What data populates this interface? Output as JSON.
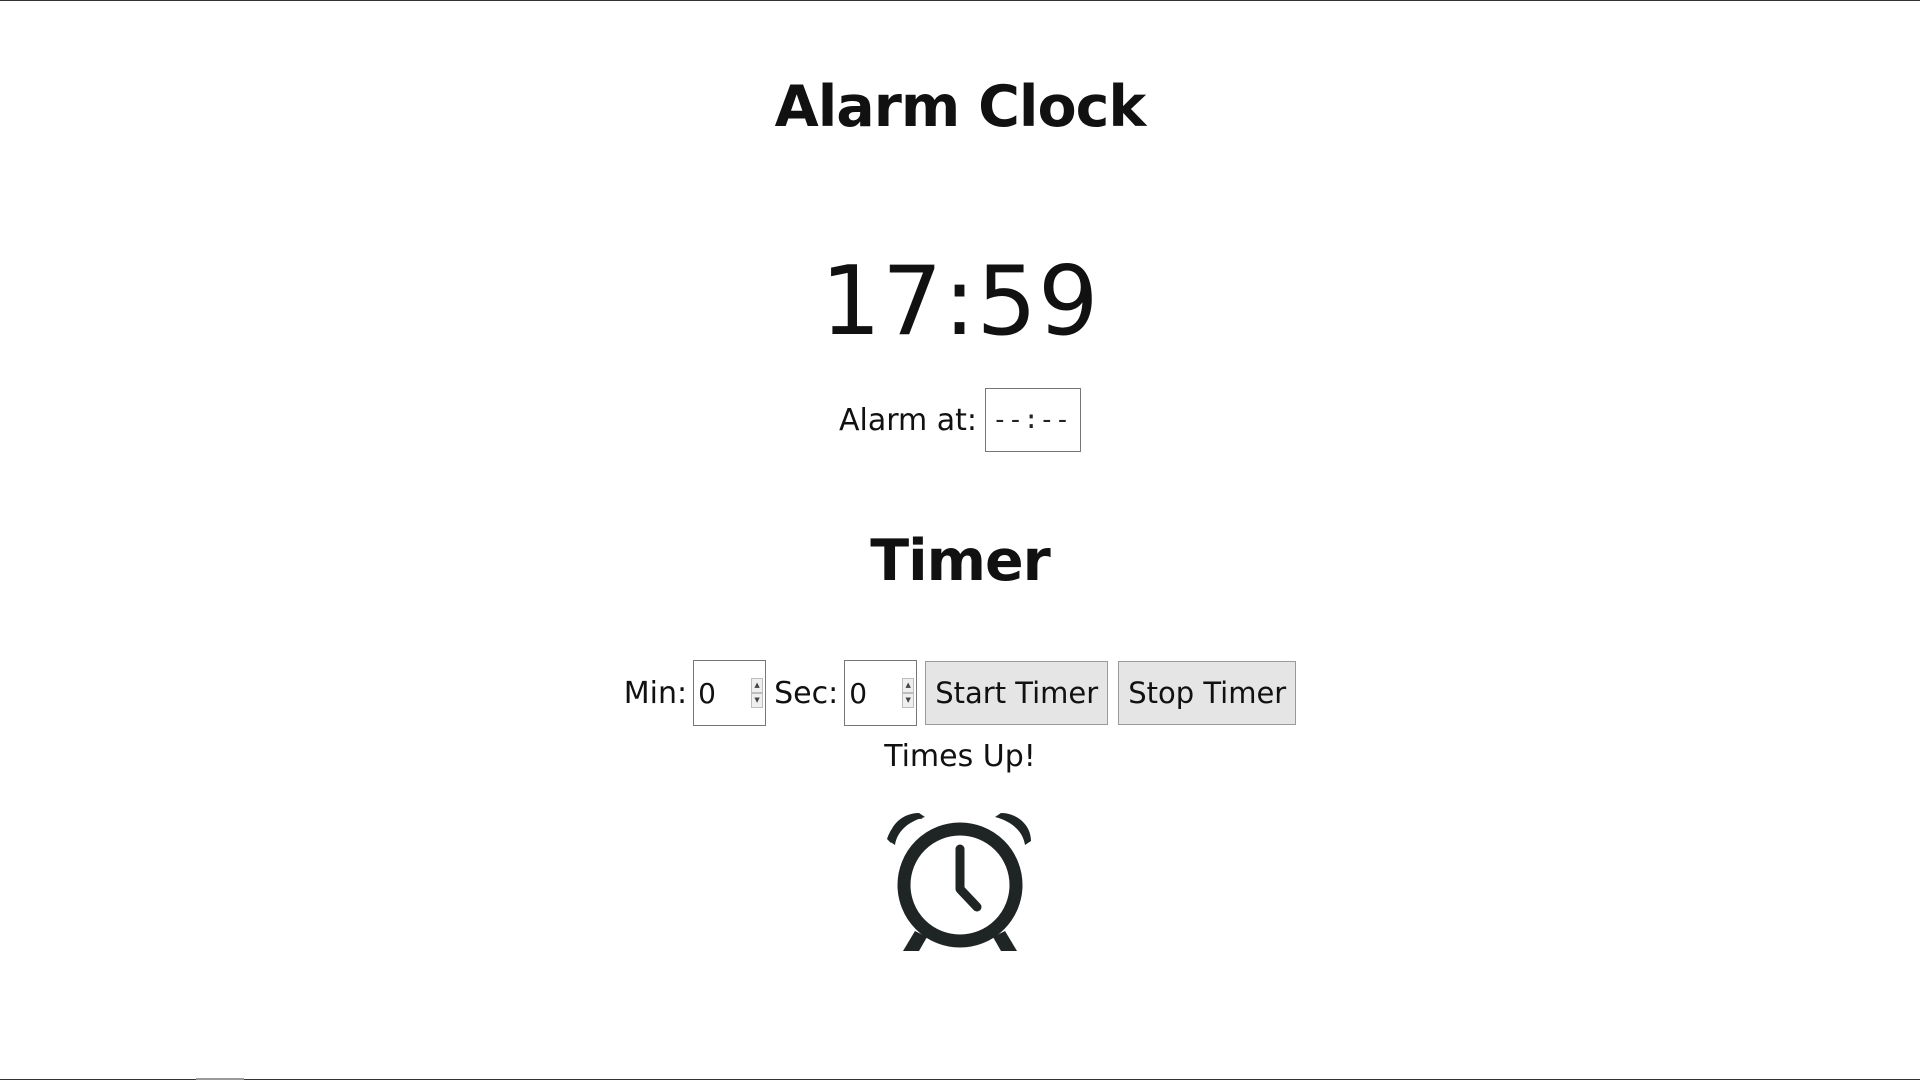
{
  "header": {
    "title": "Alarm Clock"
  },
  "clock": {
    "time": "17:59"
  },
  "alarm": {
    "label": "Alarm at:",
    "value": "--:--"
  },
  "timer": {
    "title": "Timer",
    "min_label": "Min:",
    "min_value": "0",
    "sec_label": "Sec:",
    "sec_value": "0",
    "start_label": "Start Timer",
    "stop_label": "Stop Timer",
    "status": "Times Up!"
  },
  "icons": {
    "alarm_clock": "alarm-clock-icon",
    "spin_up": "▲",
    "spin_down": "▼"
  },
  "colors": {
    "text": "#111111",
    "icon": "#1f2424",
    "button_bg": "#e5e5e5",
    "border": "#767676"
  }
}
